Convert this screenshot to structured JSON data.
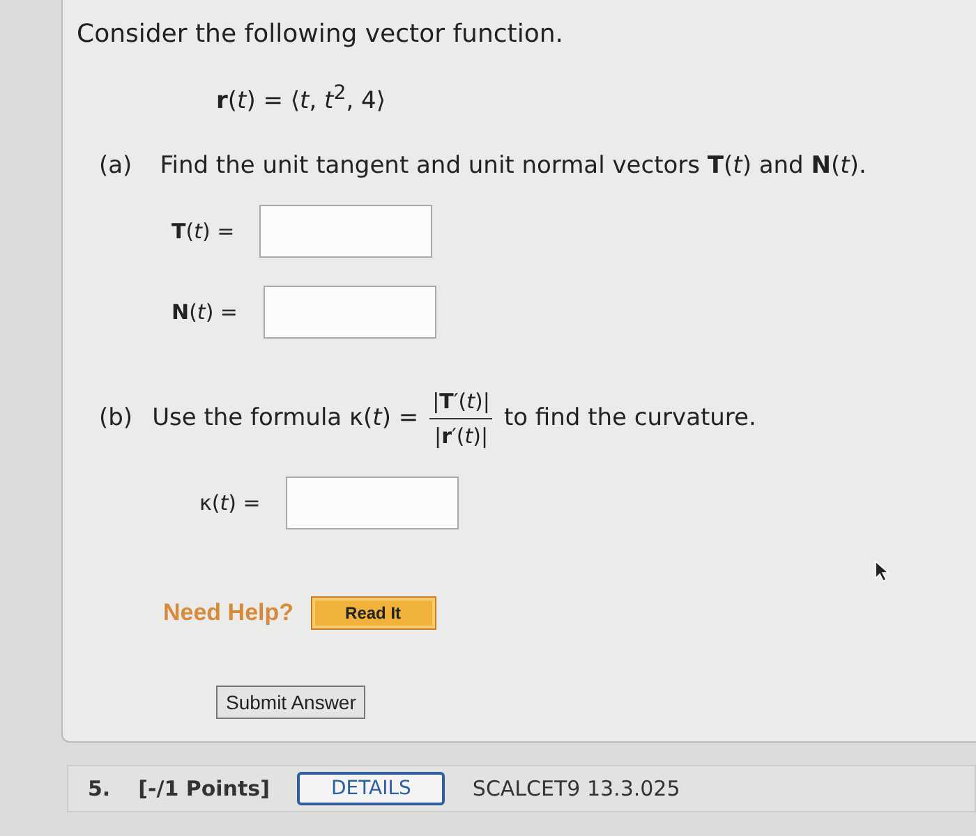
{
  "intro": "Consider the following vector function.",
  "equation": "**r**(*t*) = ⟨*t*, *t*$^{2}$, 4⟩",
  "part_a": {
    "label": "(a)",
    "prompt": "Find the unit tangent and unit normal vectors **T**(*t*) and **N**(*t*).",
    "answers": [
      {
        "label": "**T**(*t*)  ="
      },
      {
        "label": "**N**(*t*)  ="
      }
    ]
  },
  "part_b": {
    "label": "(b)",
    "prompt_before": "Use the formula κ(*t*) =",
    "numerator": "|**T**′(*t*)|",
    "denominator": "|**r**′(*t*)|",
    "prompt_after": "to find the curvature.",
    "answers": [
      {
        "label": "κ(*t*) ="
      }
    ]
  },
  "help": {
    "label": "Need Help?",
    "button": "Read It"
  },
  "submit": "Submit Answer",
  "next_question": {
    "number": "5.",
    "points": "[-/1 Points]",
    "details": "DETAILS",
    "code": "SCALCET9 13.3.025"
  }
}
